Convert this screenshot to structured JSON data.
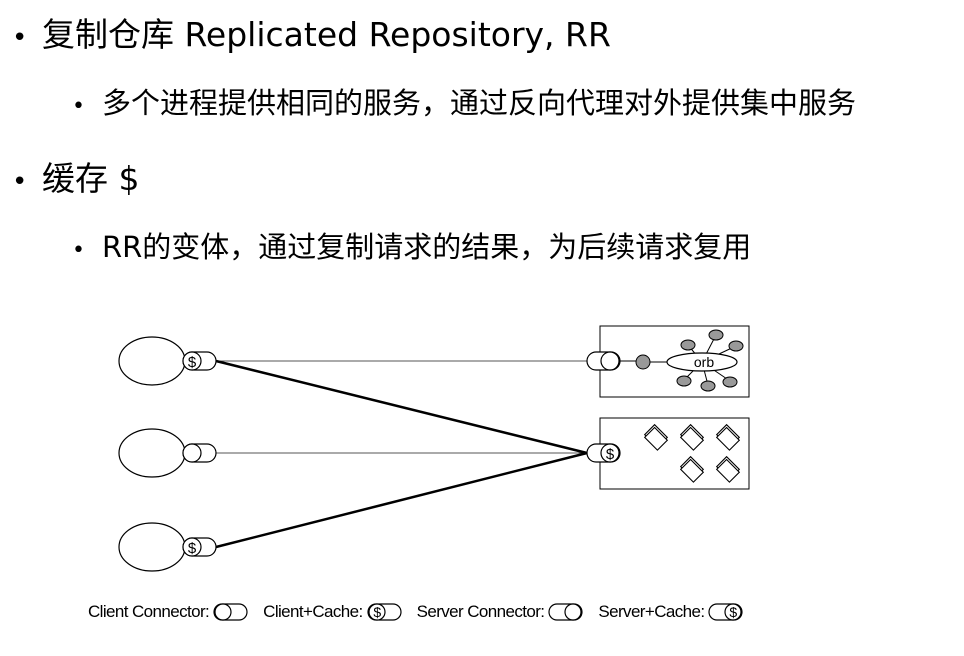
{
  "bullets": [
    {
      "text": "复制仓库 Replicated Repository, RR",
      "level": 1
    },
    {
      "text": "多个进程提供相同的服务，通过反向代理对外提供集中服务",
      "level": 2
    },
    {
      "text": "缓存 $",
      "level": 1
    },
    {
      "text": "RR的变体，通过复制请求的结果，为后续请求复用",
      "level": 2
    }
  ],
  "bullet_glyph": "•",
  "diagram": {
    "orb_label": "orb",
    "cache_symbol": "$"
  },
  "legend": {
    "client_connector": "Client Connector:",
    "client_cache": "Client+Cache:",
    "server_connector": "Server Connector:",
    "server_cache": "Server+Cache:"
  }
}
